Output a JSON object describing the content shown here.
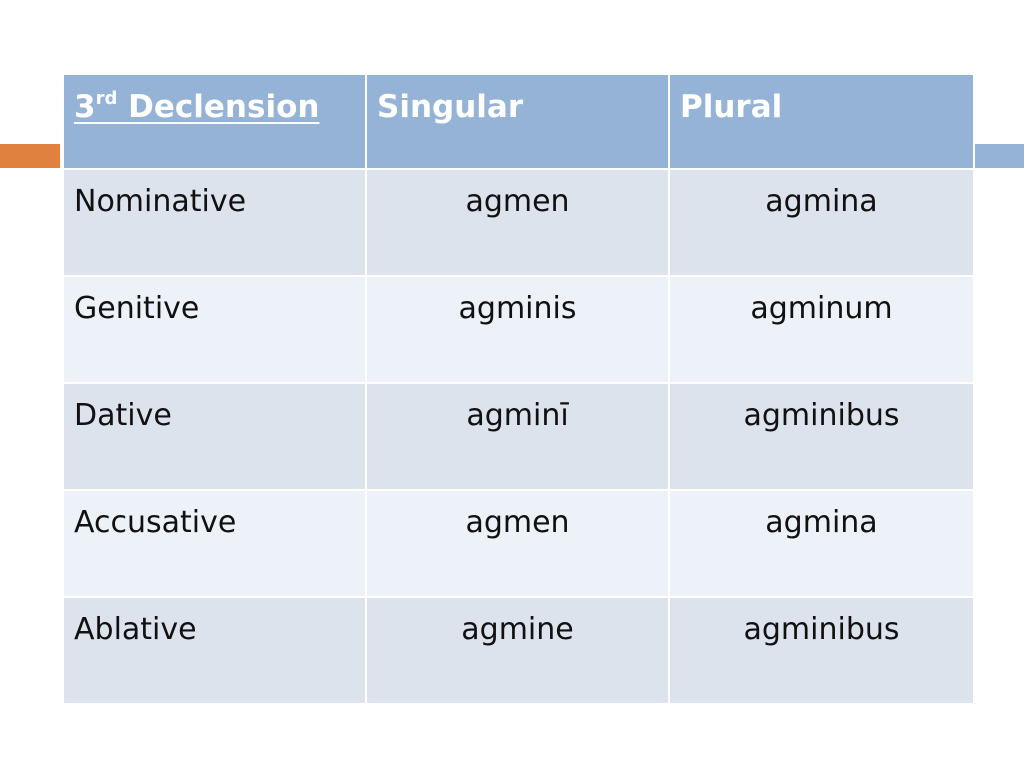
{
  "colors": {
    "header_bg": "#95b3d7",
    "row_odd_bg": "#dce3ec",
    "row_even_bg": "#edf2f8",
    "accent_orange": "#e0813f"
  },
  "table": {
    "header": {
      "col1_num": "3",
      "col1_sup": "rd",
      "col1_text": " Declension",
      "col2": "Singular",
      "col3": "Plural"
    },
    "rows": [
      {
        "case": "Nominative",
        "singular": "agmen",
        "plural": "agmina"
      },
      {
        "case": "Genitive",
        "singular": "agminis",
        "plural": "agminum"
      },
      {
        "case": "Dative",
        "singular": "agminī",
        "plural": "agminibus"
      },
      {
        "case": "Accusative",
        "singular": "agmen",
        "plural": "agmina"
      },
      {
        "case": "Ablative",
        "singular": "agmine",
        "plural": "agminibus"
      }
    ]
  }
}
